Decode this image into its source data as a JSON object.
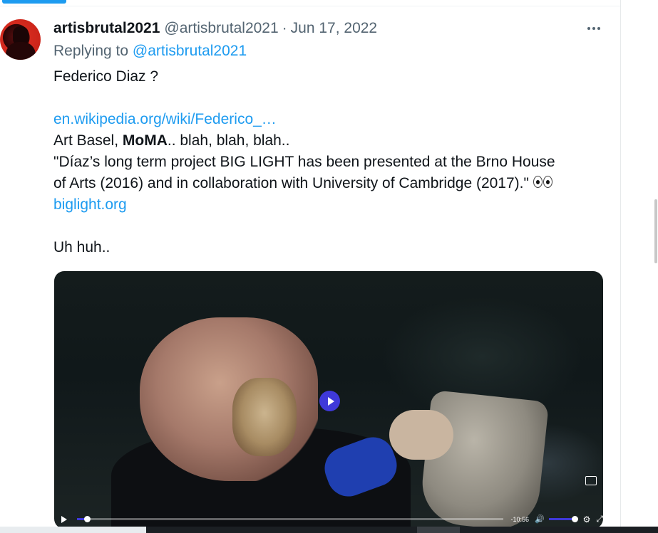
{
  "tweet": {
    "display_name": "artisbrutal2021",
    "handle": "@artisbrutal2021",
    "separator": "·",
    "date": "Jun 17, 2022",
    "replying_to_prefix": "Replying to",
    "replying_to_handle": "@artisbrutal2021",
    "lines": {
      "l1": "Federico Diaz ?",
      "link1": "en.wikipedia.org/wiki/Federico_…",
      "l3_prefix": "Art Basel, ",
      "l3_bold": "MoMA",
      "l3_suffix": ".. blah, blah, blah..",
      "l4": "\"Díaz’s long term project BIG LIGHT has been presented at the Brno House",
      "l5": "of Arts (2016) and in collaboration with University of Cambridge (2017).\"",
      "link2": "biglight.org",
      "l7": "Uh huh.."
    },
    "emoji": "eyes-emoji"
  },
  "video": {
    "time_remaining": "-10:56",
    "progress": 0.01,
    "volume": 1.0,
    "icons": {
      "play": "play-icon",
      "volume": "volume-icon",
      "settings": "gear-icon",
      "fullscreen": "fullscreen-icon",
      "pip": "picture-in-picture-icon"
    }
  },
  "colors": {
    "link": "#1d9bf0",
    "secondary_text": "#536471",
    "play_button": "#3f39d9"
  }
}
